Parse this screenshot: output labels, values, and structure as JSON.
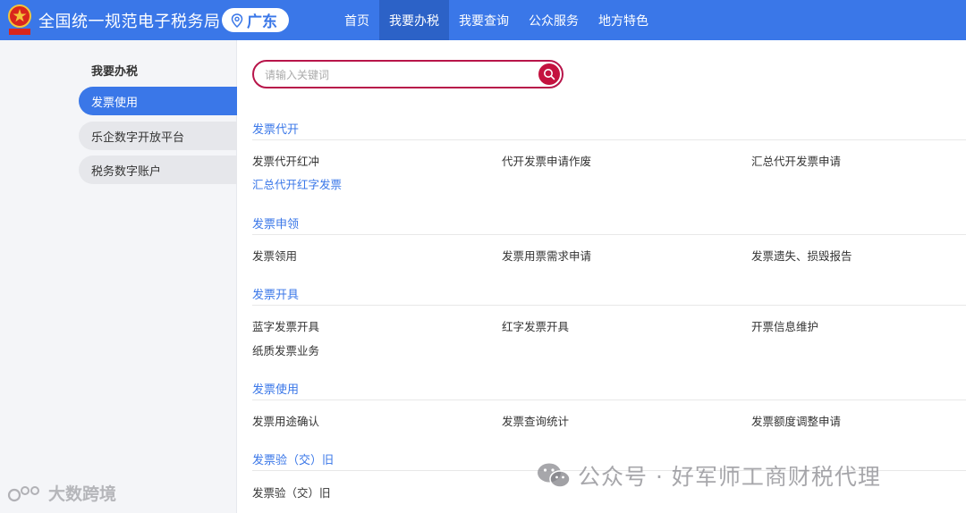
{
  "header": {
    "site_title": "全国统一规范电子税务局",
    "region": "广东",
    "nav": [
      {
        "label": "首页",
        "active": false
      },
      {
        "label": "我要办税",
        "active": true
      },
      {
        "label": "我要查询",
        "active": false
      },
      {
        "label": "公众服务",
        "active": false
      },
      {
        "label": "地方特色",
        "active": false
      }
    ],
    "colors": {
      "bar": "#3a77e8",
      "active": "#2c62c7"
    }
  },
  "sidebar": {
    "heading": "我要办税",
    "items": [
      {
        "label": "发票使用",
        "active": true
      },
      {
        "label": "乐企数字开放平台",
        "active": false
      },
      {
        "label": "税务数字账户",
        "active": false
      }
    ]
  },
  "search": {
    "placeholder": "请输入关键词",
    "value": "",
    "accent": "#c4123f"
  },
  "sections": [
    {
      "title": "发票代开",
      "links": [
        "发票代开红冲",
        "代开发票申请作废",
        "汇总代开发票申请",
        "汇总代开红字发票"
      ]
    },
    {
      "title": "发票申领",
      "links": [
        "发票领用",
        "发票用票需求申请",
        "发票遗失、损毁报告"
      ]
    },
    {
      "title": "发票开具",
      "links": [
        "蓝字发票开具",
        "红字发票开具",
        "开票信息维护",
        "纸质发票业务"
      ]
    },
    {
      "title": "发票使用",
      "links": [
        "发票用途确认",
        "发票查询统计",
        "发票额度调整申请"
      ]
    },
    {
      "title": "发票验（交）旧",
      "links": [
        "发票验（交）旧"
      ]
    }
  ],
  "watermarks": {
    "left": "大数跨境",
    "right": "公众号 · 好军师工商财税代理"
  }
}
